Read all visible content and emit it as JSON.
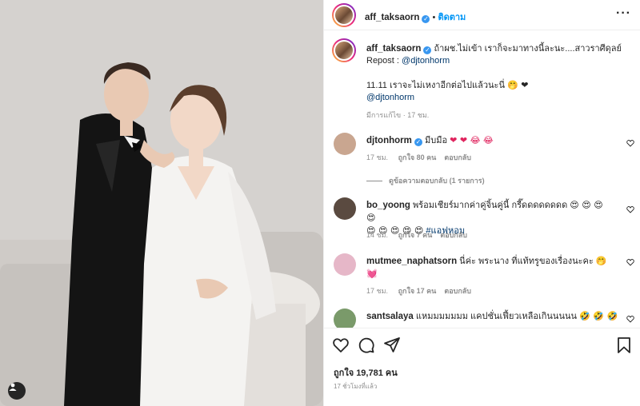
{
  "post": {
    "author": "aff_taksaorn",
    "follow_label": "ติดตาม",
    "dot": "•",
    "more": "···",
    "caption_line1": "ถ้าผช.ไม่เข้า เราก็จะมาทางนี้ละนะ....สาวราศีดุลย์",
    "repost_prefix": "Repost :",
    "repost_handle": "@djtonhorm",
    "caption_line2": "11.11 เราจะไม่เหงาอีกต่อไปแล้วนะนี่",
    "caption_emoji": "🤭 ❤",
    "caption_mention": "@djtonhorm",
    "edited": "มีการแก้ไข · 17 ชม."
  },
  "comments": [
    {
      "user": "djtonhorm",
      "verified": true,
      "text": "มีบมือ",
      "emoji": "❤ ❤ 😂 😂",
      "time": "17 ชม.",
      "likes": "ถูกใจ 80 คน",
      "reply": "ตอบกลับ",
      "avatar_color": "#c9a690"
    },
    {
      "user": "bo_yoong",
      "verified": false,
      "text": "พร้อมเชียร์มากค่าคู่จิ้นคู่นี้ กรี๊ดดดดดดดด",
      "emoji": "😍 😍 😍 😍",
      "emoji2": "😍 😍 😍 😍 😍",
      "hashtag": "#แอฟหอม",
      "time": "14 ชม.",
      "likes": "ถูกใจ 7 คน",
      "reply": "ตอบกลับ",
      "avatar_color": "#5a4a40"
    },
    {
      "user": "mutmee_naphatsorn",
      "verified": false,
      "text": "นี่ค่ะ พระนาง ที่แท้ทรูของเรื่องนะคะ",
      "emoji": "🤭",
      "emoji2": "💓",
      "time": "17 ชม.",
      "likes": "ถูกใจ 17 คน",
      "reply": "ตอบกลับ",
      "avatar_color": "#e6b7c8"
    },
    {
      "user": "santsalaya",
      "verified": false,
      "text": "แหมมมมมมม แคปชั่นเฟี้ยวเหลือเกินนนนน",
      "emoji": "🤣 🤣 🤣",
      "avatar_color": "#7a9a6a"
    }
  ],
  "view_replies": "ดูข้อความตอบกลับ (1 รายการ)",
  "footer": {
    "likes": "ถูกใจ 19,781 คน",
    "ago": "17 ชั่วโมงที่แล้ว"
  },
  "icons": {
    "verified": "verified-badge-icon",
    "heart": "heart-icon",
    "comment": "comment-icon",
    "share": "share-icon",
    "save": "bookmark-icon",
    "more": "more-options-icon",
    "user_tag": "user-tag-icon"
  },
  "colors": {
    "accent": "#0095f6",
    "verified": "#3897f0",
    "muted": "#8e8e8e",
    "text": "#262626",
    "link": "#00376b"
  }
}
